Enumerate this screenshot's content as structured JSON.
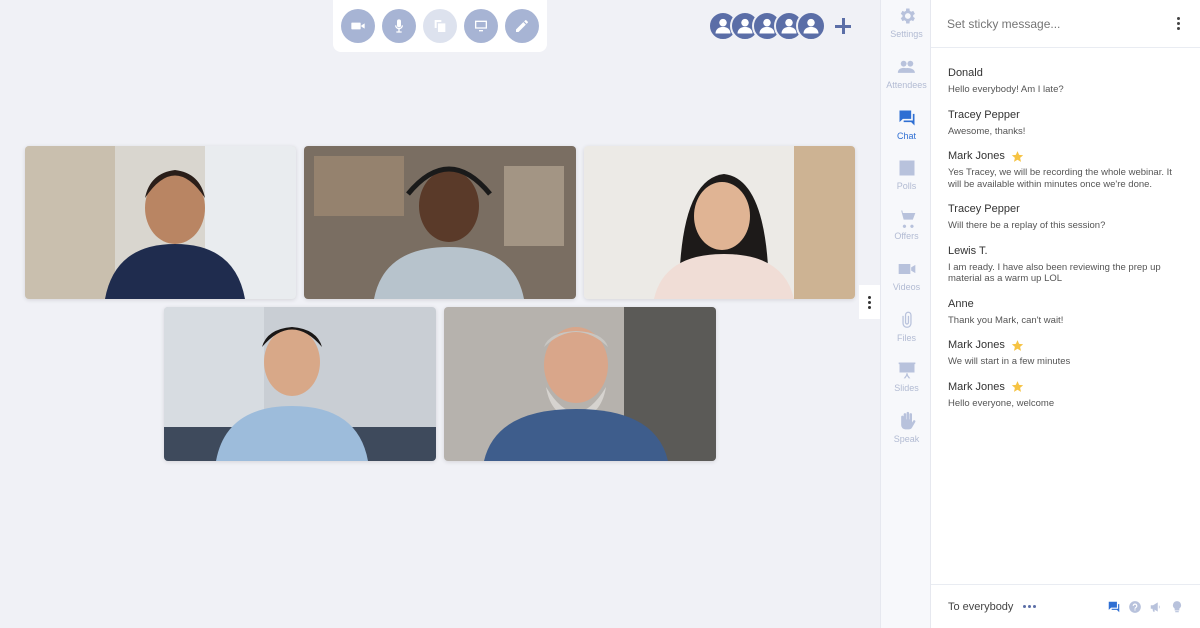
{
  "toolbar": {
    "buttons": [
      {
        "name": "camera-button",
        "icon": "video-camera-icon"
      },
      {
        "name": "microphone-button",
        "icon": "microphone-icon"
      },
      {
        "name": "share-button",
        "icon": "copy-icon"
      },
      {
        "name": "screen-share-button",
        "icon": "monitor-icon"
      },
      {
        "name": "draw-button",
        "icon": "pencil-icon"
      }
    ]
  },
  "attendee_strip": {
    "avatar_count": 5,
    "add_icon": "plus-icon"
  },
  "video_tiles": [
    {
      "name": "video-tile-1",
      "icon": "person-silhouette"
    },
    {
      "name": "video-tile-2",
      "icon": "person-silhouette"
    },
    {
      "name": "video-tile-3",
      "icon": "person-silhouette"
    },
    {
      "name": "video-tile-4",
      "icon": "person-silhouette"
    },
    {
      "name": "video-tile-5",
      "icon": "person-silhouette"
    }
  ],
  "rail": {
    "items": [
      {
        "label": "Settings",
        "icon": "gear-icon"
      },
      {
        "label": "Attendees",
        "icon": "people-icon"
      },
      {
        "label": "Chat",
        "icon": "chat-icon",
        "active": true
      },
      {
        "label": "Polls",
        "icon": "bar-chart-icon"
      },
      {
        "label": "Offers",
        "icon": "cart-icon"
      },
      {
        "label": "Videos",
        "icon": "video-icon"
      },
      {
        "label": "Files",
        "icon": "paperclip-icon"
      },
      {
        "label": "Slides",
        "icon": "presentation-icon"
      },
      {
        "label": "Speak",
        "icon": "hand-icon"
      }
    ]
  },
  "chat": {
    "sticky_placeholder": "Set sticky message...",
    "messages": [
      {
        "author": "Donald",
        "text": "Hello everybody! Am I late?",
        "starred": false
      },
      {
        "author": "Tracey Pepper",
        "text": "Awesome, thanks!",
        "starred": false
      },
      {
        "author": "Mark Jones",
        "text": "Yes Tracey, we will be recording the whole webinar. It will be available within minutes once we're done.",
        "starred": true
      },
      {
        "author": "Tracey Pepper",
        "text": "Will there be a replay of this session?",
        "starred": false
      },
      {
        "author": "Lewis T.",
        "text": "I am ready. I have also been reviewing the prep up material as a warm up LOL",
        "starred": false
      },
      {
        "author": "Anne",
        "text": "Thank you Mark, can't wait!",
        "starred": false
      },
      {
        "author": "Mark Jones",
        "text": "We will start in a few minutes",
        "starred": true
      },
      {
        "author": "Mark Jones",
        "text": "Hello everyone, welcome",
        "starred": true
      }
    ],
    "recipient": "To everybody",
    "compose_icons": [
      "chat-bubble-icon",
      "question-icon",
      "megaphone-icon",
      "lightbulb-icon"
    ]
  },
  "colors": {
    "accent": "#2f6fd3",
    "avatar": "#5b6ea7",
    "toolbar_button": "#a7b4d4",
    "star": "#f6c343"
  }
}
